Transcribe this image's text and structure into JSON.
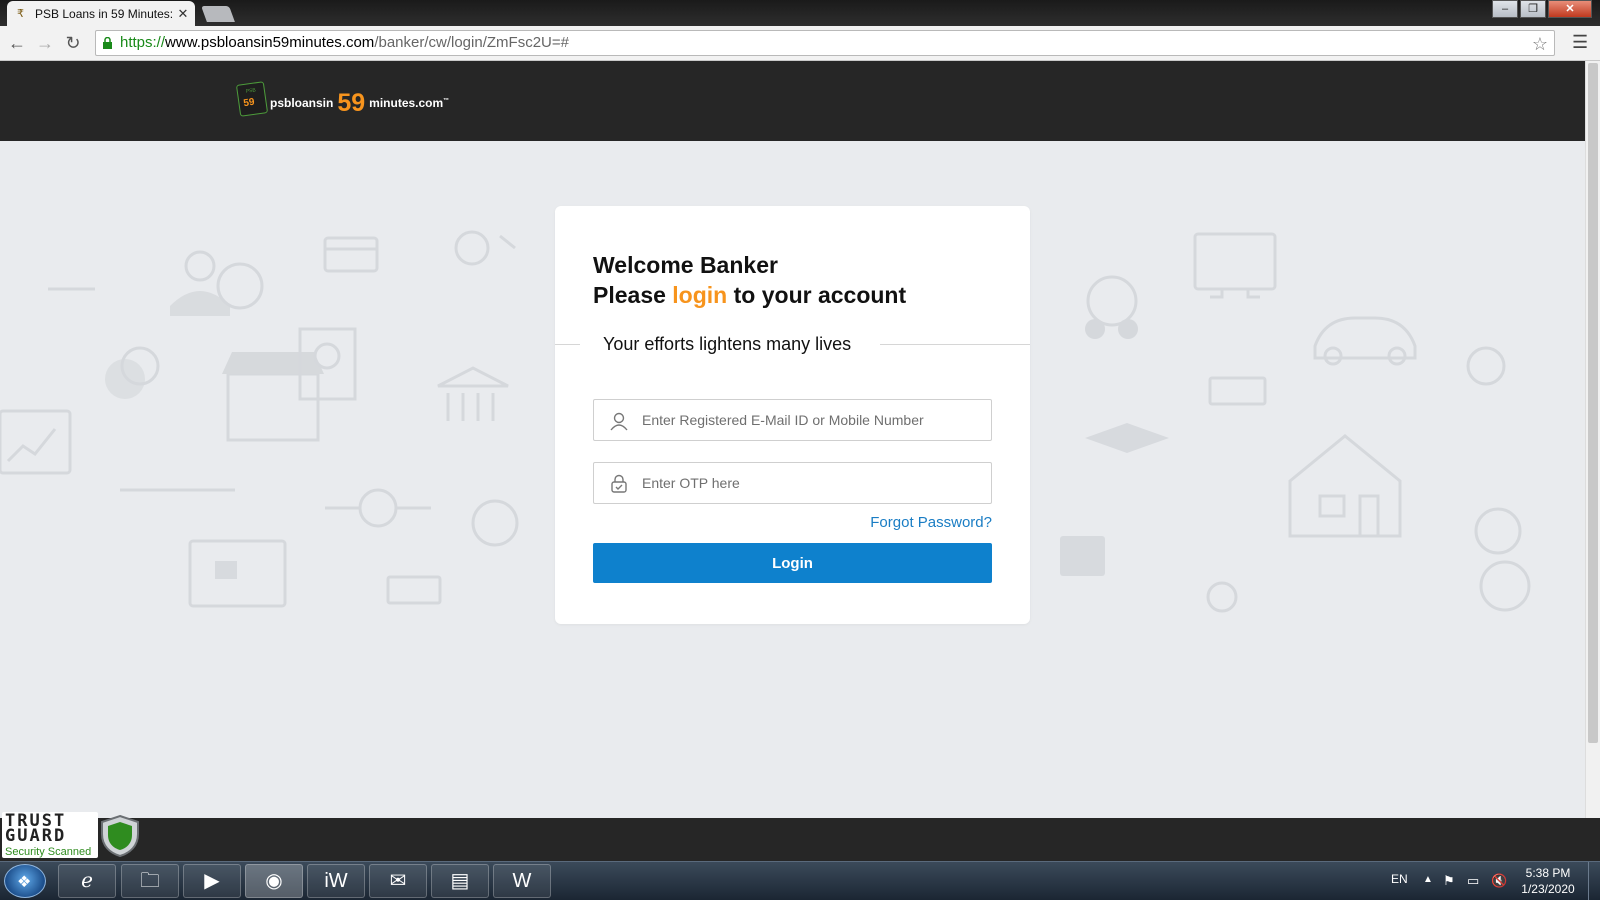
{
  "browser": {
    "tab_title": "PSB Loans in 59 Minutes:",
    "tab_close": "✕",
    "url_scheme": "https://",
    "url_host": "www.psbloansin59minutes.com",
    "url_path": "/banker/cw/login/ZmFsc2U=#",
    "window_controls": {
      "minimize": "–",
      "maximize": "❐",
      "close": "✕"
    }
  },
  "header": {
    "logo": {
      "badge_top": "PSB",
      "badge_num": "59",
      "part1": "psbloansin",
      "part2": "59",
      "part3": "minutes.com",
      "tm": "™"
    }
  },
  "login_card": {
    "welcome_line1": "Welcome Banker",
    "welcome_line2_pre": "Please ",
    "welcome_line2_accent": "login",
    "welcome_line2_post": " to your account",
    "tagline": "Your efforts lightens many lives",
    "email_placeholder": "Enter Registered E-Mail ID or Mobile Number",
    "otp_placeholder": "Enter OTP here",
    "forgot_label": "Forgot Password?",
    "login_label": "Login"
  },
  "trust_guard": {
    "word1": "TRUST",
    "word2": "GUARD",
    "caption": "Security Scanned"
  },
  "taskbar": {
    "language": "EN",
    "time": "5:38 PM",
    "date": "1/23/2020"
  },
  "colors": {
    "accent": "#f7941d",
    "primary": "#0e81cd",
    "header": "#262626"
  }
}
